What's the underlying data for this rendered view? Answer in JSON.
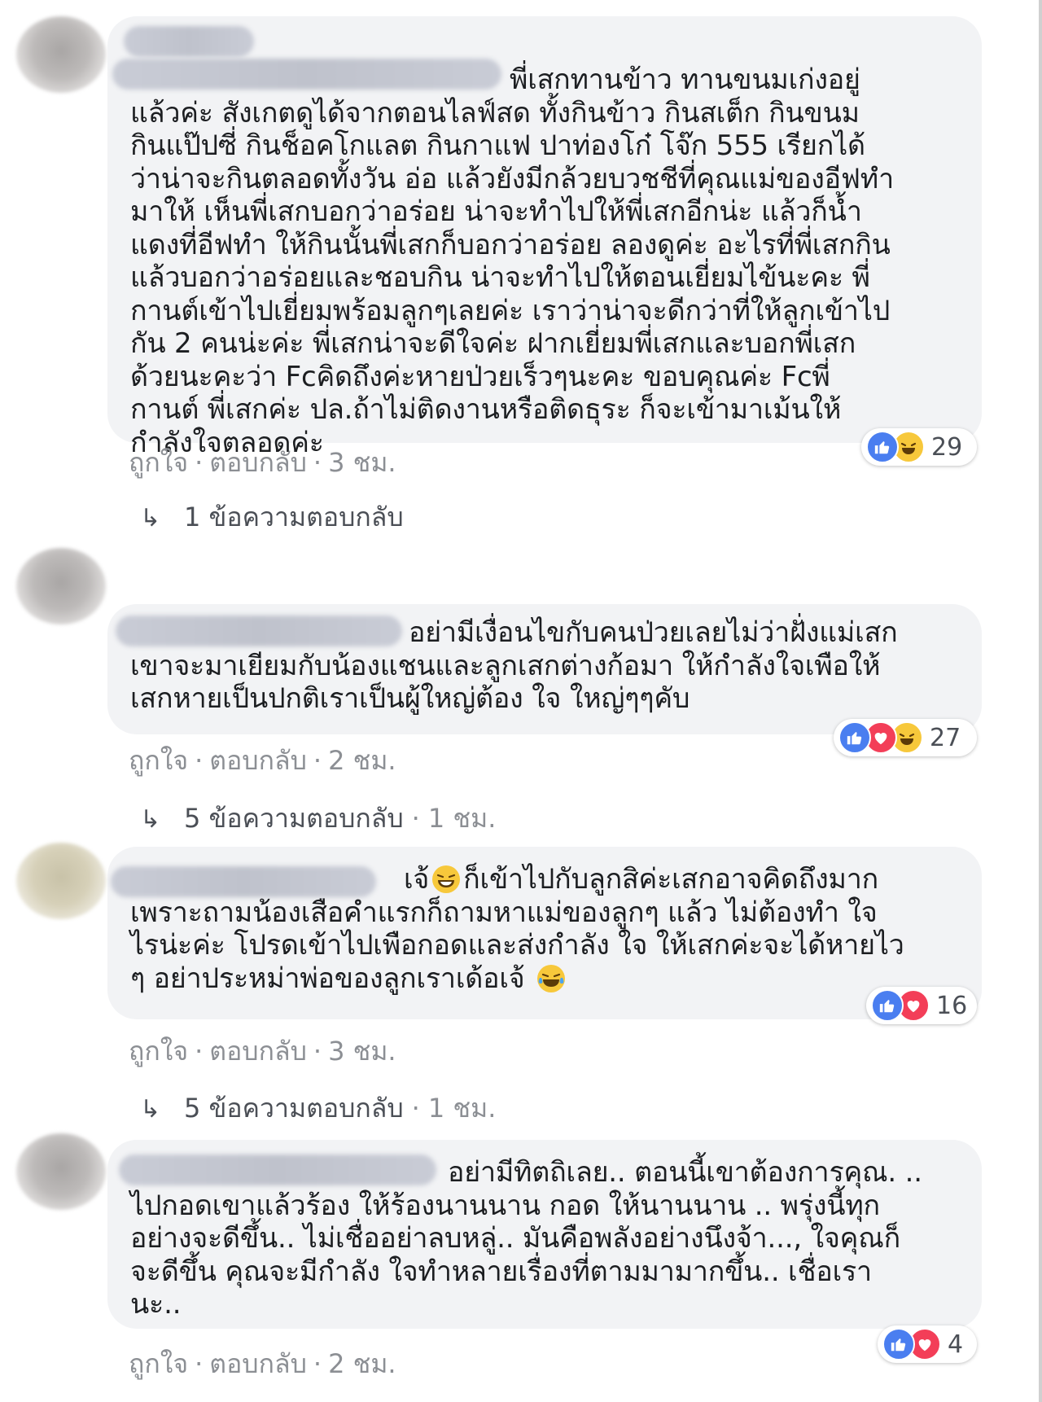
{
  "comments": [
    {
      "text": "พี่เสกทานข้าว ทานขนมเก่งอยู่\nแล้วค่ะ สังเกตดูได้จากตอนไลฟ์สด ทั้งกินข้าว กินสเต็ก กินขนม\nกินแป๊ปซี่ กินช็อคโกแลต กินกาแฟ ปาท่องโก๋ โจ๊ก 555 เรียกได้\nว่าน่าจะกินตลอดทั้งวัน อ่อ แล้วยังมีกล้วยบวชชีที่คุณแม่ของอีฟทำ\nมาให้ เห็นพี่เสกบอกว่าอร่อย น่าจะทำไปให้พี่เสกอีกน่ะ แล้วก็น้ำ\nแดงที่อีฟทำ ให้กินนั้นพี่เสกก็บอกว่าอร่อย ลองดูค่ะ อะไรที่พี่เสกกิน\nแล้วบอกว่าอร่อยและชอบกิน น่าจะทำไปให้ตอนเยี่ยมไข้นะคะ พี่\nกานต์เข้าไปเยี่ยมพร้อมลูกๆเลยค่ะ เราว่าน่าจะดีกว่าที่ให้ลูกเข้าไป\nกัน 2 คนน่ะค่ะ พี่เสกน่าจะดีใจค่ะ ฝากเยี่ยมพี่เสกและบอกพี่เสก\nด้วยนะคะว่า Fcคิดถึงค่ะหายป่วยเร็วๆนะคะ ขอบคุณค่ะ Fcพี่\nกานต์ พี่เสกค่ะ ปล.ถ้าไม่ติดงานหรือติดธุระ ก็จะเข้ามาเม้นให้\nกำลังใจตลอดค่ะ",
      "like_label": "ถูกใจ",
      "reply_label": "ตอบกลับ",
      "time": "3 ชม.",
      "reaction_count": "29",
      "reactions": [
        "like",
        "haha"
      ],
      "replies_label": "1 ข้อความตอบกลับ",
      "replies_time": ""
    },
    {
      "text": "อย่ามีเงื่อนไขกับคนป่วยเลยไม่ว่าฝั่งแม่เสก\nเขาจะมาเยียมกับน้องแชนและลูกเสกต่างก้อมา ให้กำลังใจเพือให้\nเสกหายเป็นปกติเราเป็นผู้ใหญ่ต้อง ใจ ใหญ่ๆๆคับ",
      "like_label": "ถูกใจ",
      "reply_label": "ตอบกลับ",
      "time": "2 ชม.",
      "reaction_count": "27",
      "reactions": [
        "like",
        "love",
        "haha"
      ],
      "replies_label": "5 ข้อความตอบกลับ",
      "replies_time": "1 ชม."
    },
    {
      "text_before_emoji": "เจ้",
      "text": "ก็เข้าไปกับลูกสิค่ะเสกอาจคิดถึงมาก\nเพราะถามน้องเสือคำแรกก็ถามหาแม่ของลูกๆ แล้ว ไม่ต้องทำ ใจ\nไรน่ะค่ะ โปรดเข้าไปเพือกอดและส่งกำลัง ใจ ให้เสกค่ะจะได้หายไว\nๆ อย่าประหม่าพ่อของลูกเราเด้อเจ้",
      "like_label": "ถูกใจ",
      "reply_label": "ตอบกลับ",
      "time": "3 ชม.",
      "reaction_count": "16",
      "reactions": [
        "like",
        "love"
      ],
      "replies_label": "5 ข้อความตอบกลับ",
      "replies_time": "1 ชม."
    },
    {
      "text": "อย่ามีทิตถิเลย.. ตอนนี้เขาต้องการคุณ. ..\nไปกอดเขาแล้วร้อง ให้ร้องนานนาน กอด ให้นานนาน .. พรุ่งนี้ทุก\nอย่างจะดีขึ้น.. ไม่เชื่ออย่าลบหลู่.. มันคือพลังอย่างนึงจ้า..., ใจคุณก็\nจะดีขึ้น คุณจะมีกำลัง ใจทำหลายเรื่องที่ตามมามากขึ้น.. เชื่อเรา\nนะ..",
      "like_label": "ถูกใจ",
      "reply_label": "ตอบกลับ",
      "time": "2 ชม.",
      "reaction_count": "4",
      "reactions": [
        "like",
        "love"
      ]
    }
  ],
  "separator": "·",
  "colors": {
    "bubble": "#f2f3f5",
    "meta": "#8c8f94",
    "like": "#4a7ef0",
    "love": "#f33e58",
    "haha": "#f7c83b"
  }
}
